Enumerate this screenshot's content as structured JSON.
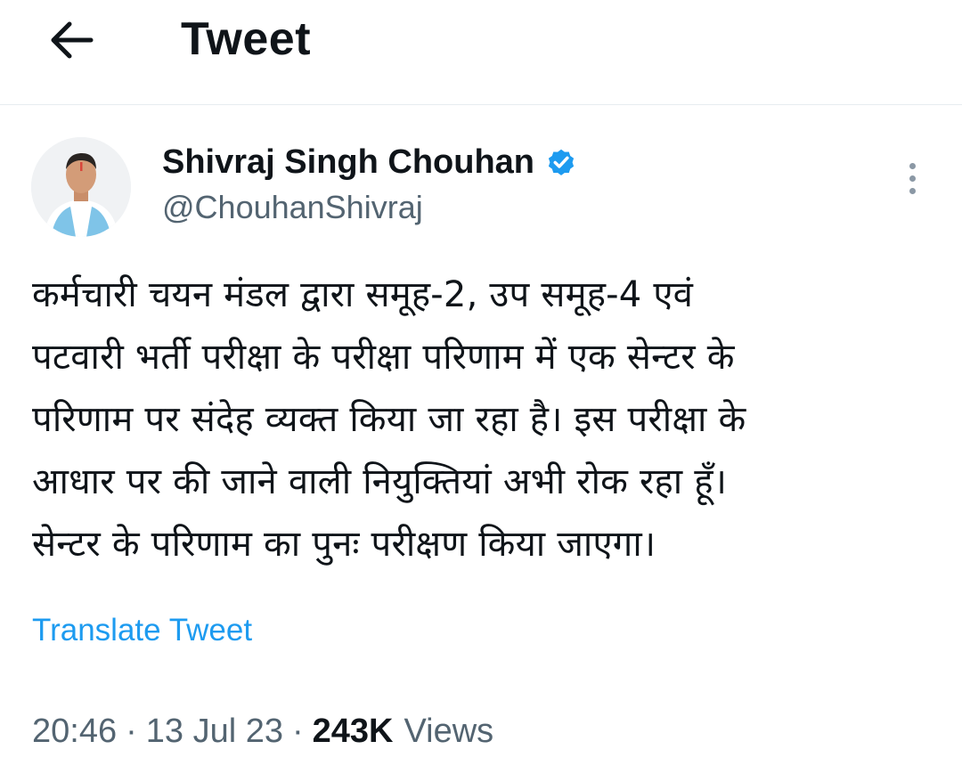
{
  "header": {
    "title": "Tweet",
    "back_icon": "arrow-left-icon"
  },
  "author": {
    "name": "Shivraj Singh Chouhan",
    "handle": "@ChouhanShivraj",
    "verified_color": "#1d9bf0"
  },
  "tweet": {
    "text": "कर्मचारी चयन मंडल द्वारा समूह-2, उप समूह-4 एवं\nपटवारी भर्ती परीक्षा के परीक्षा परिणाम में एक सेन्टर के\nपरिणाम पर संदेह व्यक्त किया जा रहा है। इस परीक्षा के\nआधार पर की जाने वाली नियुक्तियां अभी रोक रहा हूँ।\nसेन्टर के परिणाम का पुनः परीक्षण किया जाएगा।",
    "translate_label": "Translate Tweet"
  },
  "meta": {
    "time": "20:46",
    "date": "13 Jul 23",
    "separator": "·",
    "views_count": "243K",
    "views_label": "Views"
  },
  "colors": {
    "accent": "#1d9bf0",
    "secondary_text": "#536471",
    "primary_text": "#0f1419"
  }
}
